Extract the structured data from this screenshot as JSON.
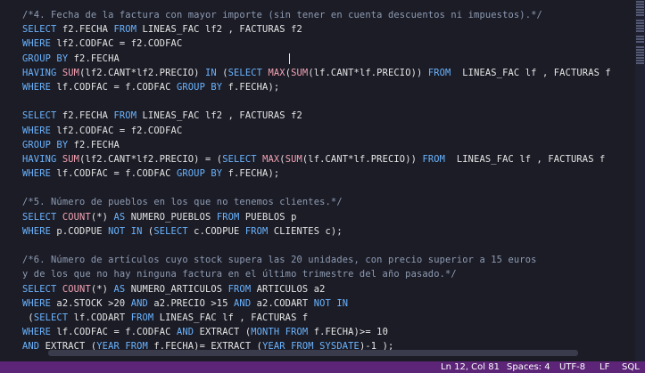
{
  "editor": {
    "lines": [
      [
        [
          "comment",
          "/*4. Fecha de la factura con mayor importe (sin tener en cuenta descuentos ni impuestos).*/"
        ]
      ],
      [
        [
          "keyword",
          "SELECT"
        ],
        [
          "plain",
          " f2.FECHA "
        ],
        [
          "keyword",
          "FROM"
        ],
        [
          "plain",
          " LINEAS_FAC lf2 , FACTURAS f2"
        ]
      ],
      [
        [
          "keyword",
          "WHERE"
        ],
        [
          "plain",
          " lf2.CODFAC = f2.CODFAC"
        ]
      ],
      [
        [
          "keyword",
          "GROUP BY"
        ],
        [
          "plain",
          " f2.FECHA"
        ]
      ],
      [
        [
          "keyword",
          "HAVING"
        ],
        [
          "plain",
          " "
        ],
        [
          "function",
          "SUM"
        ],
        [
          "plain",
          "(lf2.CANT*lf2.PRECIO) "
        ],
        [
          "keyword",
          "IN"
        ],
        [
          "plain",
          " ("
        ],
        [
          "keyword",
          "SELECT"
        ],
        [
          "plain",
          " "
        ],
        [
          "function",
          "MAX"
        ],
        [
          "plain",
          "("
        ],
        [
          "function",
          "SUM"
        ],
        [
          "plain",
          "(lf.CANT*lf.PRECIO)) "
        ],
        [
          "keyword",
          "FROM"
        ],
        [
          "plain",
          "  LINEAS_FAC lf , FACTURAS f"
        ]
      ],
      [
        [
          "keyword",
          "WHERE"
        ],
        [
          "plain",
          " lf.CODFAC = f.CODFAC "
        ],
        [
          "keyword",
          "GROUP BY"
        ],
        [
          "plain",
          " f.FECHA);"
        ]
      ],
      [],
      [
        [
          "keyword",
          "SELECT"
        ],
        [
          "plain",
          " f2.FECHA "
        ],
        [
          "keyword",
          "FROM"
        ],
        [
          "plain",
          " LINEAS_FAC lf2 , FACTURAS f2"
        ]
      ],
      [
        [
          "keyword",
          "WHERE"
        ],
        [
          "plain",
          " lf2.CODFAC = f2.CODFAC"
        ]
      ],
      [
        [
          "keyword",
          "GROUP BY"
        ],
        [
          "plain",
          " f2.FECHA"
        ]
      ],
      [
        [
          "keyword",
          "HAVING"
        ],
        [
          "plain",
          " "
        ],
        [
          "function",
          "SUM"
        ],
        [
          "plain",
          "(lf2.CANT*lf2.PRECIO) = ("
        ],
        [
          "keyword",
          "SELECT"
        ],
        [
          "plain",
          " "
        ],
        [
          "function",
          "MAX"
        ],
        [
          "plain",
          "("
        ],
        [
          "function",
          "SUM"
        ],
        [
          "plain",
          "(lf.CANT*lf.PRECIO)) "
        ],
        [
          "keyword",
          "FROM"
        ],
        [
          "plain",
          "  LINEAS_FAC lf , FACTURAS f"
        ]
      ],
      [
        [
          "keyword",
          "WHERE"
        ],
        [
          "plain",
          " lf.CODFAC = f.CODFAC "
        ],
        [
          "keyword",
          "GROUP BY"
        ],
        [
          "plain",
          " f.FECHA);"
        ]
      ],
      [],
      [
        [
          "comment",
          "/*5. Número de pueblos en los que no tenemos clientes.*/"
        ]
      ],
      [
        [
          "keyword",
          "SELECT"
        ],
        [
          "plain",
          " "
        ],
        [
          "function",
          "COUNT"
        ],
        [
          "plain",
          "(*) "
        ],
        [
          "keyword",
          "AS"
        ],
        [
          "plain",
          " NUMERO_PUEBLOS "
        ],
        [
          "keyword",
          "FROM"
        ],
        [
          "plain",
          " PUEBLOS p"
        ]
      ],
      [
        [
          "keyword",
          "WHERE"
        ],
        [
          "plain",
          " p.CODPUE "
        ],
        [
          "keyword",
          "NOT IN"
        ],
        [
          "plain",
          " ("
        ],
        [
          "keyword",
          "SELECT"
        ],
        [
          "plain",
          " c.CODPUE "
        ],
        [
          "keyword",
          "FROM"
        ],
        [
          "plain",
          " CLIENTES c);"
        ]
      ],
      [],
      [
        [
          "comment",
          "/*6. Número de artículos cuyo stock supera las 20 unidades, con precio superior a 15 euros"
        ]
      ],
      [
        [
          "comment",
          "y de los que no hay ninguna factura en el último trimestre del año pasado.*/"
        ]
      ],
      [
        [
          "keyword",
          "SELECT"
        ],
        [
          "plain",
          " "
        ],
        [
          "function",
          "COUNT"
        ],
        [
          "plain",
          "(*) "
        ],
        [
          "keyword",
          "AS"
        ],
        [
          "plain",
          " NUMERO_ARTICULOS "
        ],
        [
          "keyword",
          "FROM"
        ],
        [
          "plain",
          " ARTICULOS a2"
        ]
      ],
      [
        [
          "keyword",
          "WHERE"
        ],
        [
          "plain",
          " a2.STOCK >20 "
        ],
        [
          "keyword",
          "AND"
        ],
        [
          "plain",
          " a2.PRECIO >15 "
        ],
        [
          "keyword",
          "AND"
        ],
        [
          "plain",
          " a2.CODART "
        ],
        [
          "keyword",
          "NOT IN"
        ]
      ],
      [
        [
          "plain",
          " ("
        ],
        [
          "keyword",
          "SELECT"
        ],
        [
          "plain",
          " lf.CODART "
        ],
        [
          "keyword",
          "FROM"
        ],
        [
          "plain",
          " LINEAS_FAC lf , FACTURAS f"
        ]
      ],
      [
        [
          "keyword",
          "WHERE"
        ],
        [
          "plain",
          " lf.CODFAC = f.CODFAC "
        ],
        [
          "keyword",
          "AND"
        ],
        [
          "plain",
          " EXTRACT ("
        ],
        [
          "keyword",
          "MONTH"
        ],
        [
          "plain",
          " "
        ],
        [
          "keyword",
          "FROM"
        ],
        [
          "plain",
          " f.FECHA)>= 10"
        ]
      ],
      [
        [
          "keyword",
          "AND"
        ],
        [
          "plain",
          " EXTRACT ("
        ],
        [
          "keyword",
          "YEAR"
        ],
        [
          "plain",
          " "
        ],
        [
          "keyword",
          "FROM"
        ],
        [
          "plain",
          " f.FECHA)= EXTRACT ("
        ],
        [
          "keyword",
          "YEAR"
        ],
        [
          "plain",
          " "
        ],
        [
          "keyword",
          "FROM"
        ],
        [
          "plain",
          " "
        ],
        [
          "keyword",
          "SYSDATE"
        ],
        [
          "plain",
          ")-1 );"
        ]
      ]
    ]
  },
  "statusbar": {
    "position": "Ln 12, Col 81",
    "indent": "Spaces: 4",
    "encoding": "UTF-8",
    "eol": "LF",
    "language": "SQL"
  },
  "colors": {
    "background": "#1b1c26",
    "keyword": "#6bb4ff",
    "function": "#f4a3b4",
    "comment": "#8f9cb3",
    "plain": "#e6e6e6",
    "statusbar": "#5c2578"
  }
}
